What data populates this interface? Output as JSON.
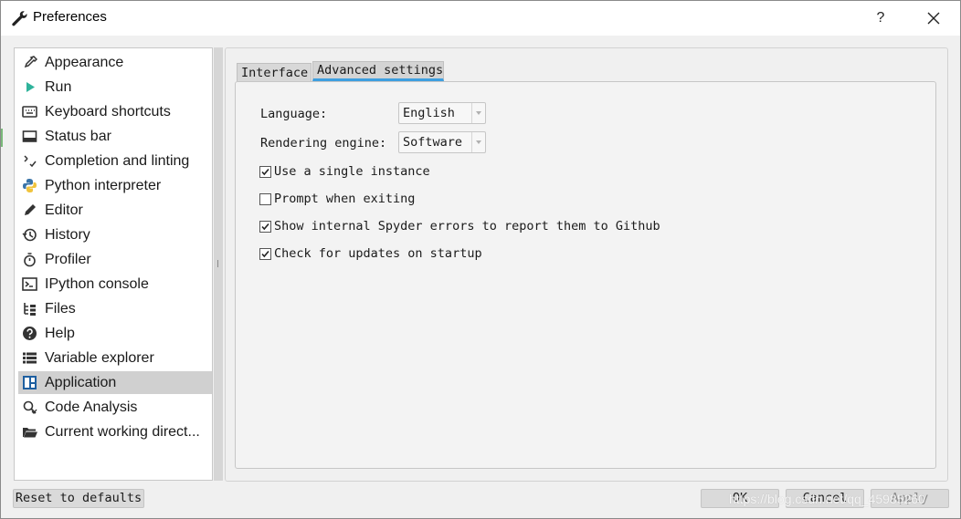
{
  "window": {
    "title": "Preferences",
    "help_label": "?"
  },
  "sidebar": {
    "items": [
      {
        "label": "Appearance",
        "icon": "paint-dropper-icon"
      },
      {
        "label": "Run",
        "icon": "play-icon"
      },
      {
        "label": "Keyboard shortcuts",
        "icon": "keyboard-icon"
      },
      {
        "label": "Status bar",
        "icon": "status-bar-icon"
      },
      {
        "label": "Completion and linting",
        "icon": "completion-icon"
      },
      {
        "label": "Python interpreter",
        "icon": "python-icon"
      },
      {
        "label": "Editor",
        "icon": "pencil-icon"
      },
      {
        "label": "History",
        "icon": "history-icon"
      },
      {
        "label": "Profiler",
        "icon": "stopwatch-icon"
      },
      {
        "label": "IPython console",
        "icon": "terminal-icon"
      },
      {
        "label": "Files",
        "icon": "file-tree-icon"
      },
      {
        "label": "Help",
        "icon": "question-icon"
      },
      {
        "label": "Variable explorer",
        "icon": "list-icon"
      },
      {
        "label": "Application",
        "icon": "application-icon",
        "selected": true
      },
      {
        "label": "Code Analysis",
        "icon": "code-analysis-icon"
      },
      {
        "label": "Current working direct...",
        "icon": "folder-open-icon"
      }
    ]
  },
  "tabs": {
    "interface": "Interface",
    "advanced": "Advanced settings",
    "active_color": "#3d9fe0"
  },
  "advanced": {
    "language_label": "Language:",
    "language_value": "English",
    "rendering_label": "Rendering engine:",
    "rendering_value": "Software",
    "options": [
      {
        "label": "Use a single instance",
        "checked": true
      },
      {
        "label": "Prompt when exiting",
        "checked": false
      },
      {
        "label": "Show internal Spyder errors to report them to Github",
        "checked": true
      },
      {
        "label": "Check for updates on startup",
        "checked": true
      }
    ]
  },
  "footer": {
    "reset_label": "Reset to defaults",
    "ok_label": "OK",
    "cancel_label": "Cancel",
    "apply_label": "Apply"
  },
  "watermark": "https://blog.csdn.net/qq_45985260"
}
